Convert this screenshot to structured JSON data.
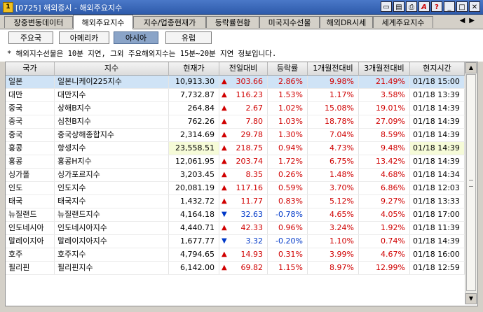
{
  "window": {
    "icon_label": "1",
    "title": "[0725] 해외증시 - 해외주요지수"
  },
  "tabs": [
    "장중변동데이터",
    "해외주요지수",
    "지수/업종현재가",
    "등락률현황",
    "미국지수선물",
    "해외DR시세",
    "세계주요지수"
  ],
  "active_tab": 1,
  "regions": [
    "주요국",
    "아메리카",
    "아시아",
    "유럽"
  ],
  "active_region": 2,
  "notice": "* 해외지수선물은 10분 지연, 그외 주요해외지수는 15분~20분 지연 정보입니다.",
  "columns": [
    "국가",
    "지수",
    "현재가",
    "전일대비",
    "등락률",
    "1개월전대비",
    "3개월전대비",
    "현지시간"
  ],
  "rows": [
    {
      "country": "일본",
      "index": "일본니케이225지수",
      "price": "10,913.30",
      "dir": "up",
      "change": "303.66",
      "rate": "2.86%",
      "m1": "9.98%",
      "m3": "21.49%",
      "time": "01/18 15:00"
    },
    {
      "country": "대만",
      "index": "대만지수",
      "price": "7,732.87",
      "dir": "up",
      "change": "116.23",
      "rate": "1.53%",
      "m1": "1.17%",
      "m3": "3.58%",
      "time": "01/18 13:39"
    },
    {
      "country": "중국",
      "index": "상해B지수",
      "price": "264.84",
      "dir": "up",
      "change": "2.67",
      "rate": "1.02%",
      "m1": "15.08%",
      "m3": "19.01%",
      "time": "01/18 14:39"
    },
    {
      "country": "중국",
      "index": "심천B지수",
      "price": "762.26",
      "dir": "up",
      "change": "7.80",
      "rate": "1.03%",
      "m1": "18.78%",
      "m3": "27.09%",
      "time": "01/18 14:39"
    },
    {
      "country": "중국",
      "index": "중국상해종합지수",
      "price": "2,314.69",
      "dir": "up",
      "change": "29.78",
      "rate": "1.30%",
      "m1": "7.04%",
      "m3": "8.59%",
      "time": "01/18 14:39"
    },
    {
      "country": "홍콩",
      "index": "항셍지수",
      "price": "23,558.51",
      "dir": "up",
      "change": "218.75",
      "rate": "0.94%",
      "m1": "4.73%",
      "m3": "9.48%",
      "time": "01/18 14:39"
    },
    {
      "country": "홍콩",
      "index": "홍콩H지수",
      "price": "12,061.95",
      "dir": "up",
      "change": "203.74",
      "rate": "1.72%",
      "m1": "6.75%",
      "m3": "13.42%",
      "time": "01/18 14:39"
    },
    {
      "country": "싱가폴",
      "index": "싱가포르지수",
      "price": "3,203.45",
      "dir": "up",
      "change": "8.35",
      "rate": "0.26%",
      "m1": "1.48%",
      "m3": "4.68%",
      "time": "01/18 14:34"
    },
    {
      "country": "인도",
      "index": "인도지수",
      "price": "20,081.19",
      "dir": "up",
      "change": "117.16",
      "rate": "0.59%",
      "m1": "3.70%",
      "m3": "6.86%",
      "time": "01/18 12:03"
    },
    {
      "country": "태국",
      "index": "태국지수",
      "price": "1,432.72",
      "dir": "up",
      "change": "11.77",
      "rate": "0.83%",
      "m1": "5.12%",
      "m3": "9.27%",
      "time": "01/18 13:33"
    },
    {
      "country": "뉴질랜드",
      "index": "뉴질랜드지수",
      "price": "4,164.18",
      "dir": "dn",
      "change": "32.63",
      "rate": "-0.78%",
      "m1": "4.65%",
      "m3": "4.05%",
      "time": "01/18 17:00"
    },
    {
      "country": "인도네시아",
      "index": "인도네시아지수",
      "price": "4,440.71",
      "dir": "up",
      "change": "42.33",
      "rate": "0.96%",
      "m1": "3.24%",
      "m3": "1.92%",
      "time": "01/18 11:39"
    },
    {
      "country": "말레이지아",
      "index": "말레이지아지수",
      "price": "1,677.77",
      "dir": "dn",
      "change": "3.32",
      "rate": "-0.20%",
      "m1": "1.10%",
      "m3": "0.74%",
      "time": "01/18 14:39"
    },
    {
      "country": "호주",
      "index": "호주지수",
      "price": "4,794.65",
      "dir": "up",
      "change": "14.93",
      "rate": "0.31%",
      "m1": "3.99%",
      "m3": "4.67%",
      "time": "01/18 16:00"
    },
    {
      "country": "필리핀",
      "index": "필리핀지수",
      "price": "6,142.00",
      "dir": "up",
      "change": "69.82",
      "rate": "1.15%",
      "m1": "8.97%",
      "m3": "12.99%",
      "time": "01/18 12:59"
    }
  ],
  "colors": {
    "up": "#d00000",
    "down": "#0038c8",
    "selected_row": "#cfe3f6",
    "active_region_button": "#8aa4c8",
    "titlebar": "#2e5bab"
  },
  "icons": {
    "up": "▲",
    "down": "▼"
  }
}
